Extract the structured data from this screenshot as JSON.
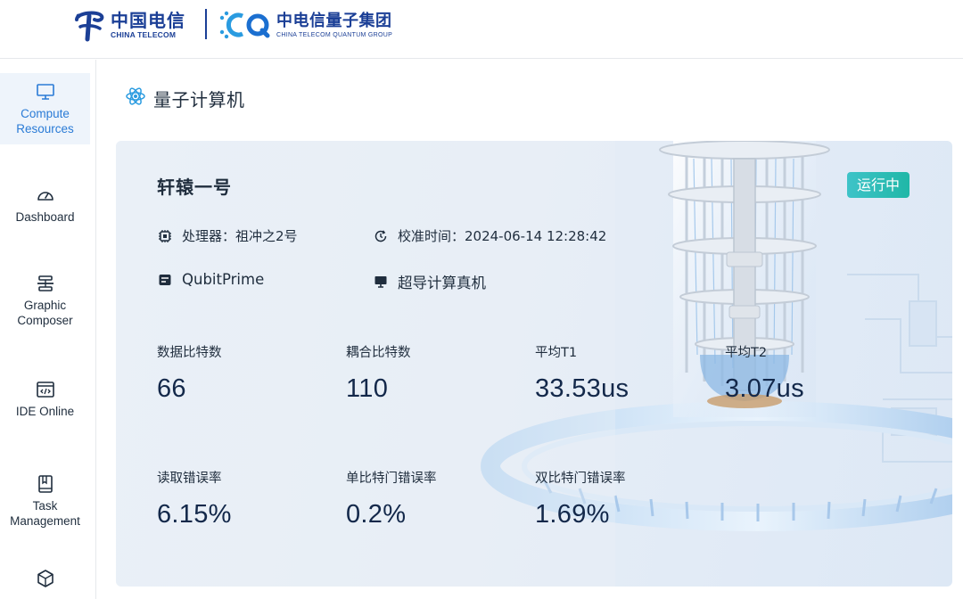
{
  "header": {
    "brand_cn": "中国电信",
    "brand_en": "CHINA TELECOM",
    "quantum_cn": "中电信量子集团",
    "quantum_en": "CHINA TELECOM QUANTUM GROUP"
  },
  "sidebar": {
    "items": [
      {
        "label": "Compute Resources",
        "icon": "monitor-icon",
        "active": true
      },
      {
        "label": "Dashboard",
        "icon": "gauge-icon"
      },
      {
        "label": "Graphic Composer",
        "icon": "layers-icon"
      },
      {
        "label": "IDE Online",
        "icon": "code-window-icon"
      },
      {
        "label": "Task Management",
        "icon": "book-icon"
      },
      {
        "label": "",
        "icon": "cube-icon"
      }
    ]
  },
  "page": {
    "title": "量子计算机",
    "title_icon": "quantum-icon"
  },
  "device": {
    "name": "轩辕一号",
    "status": "运行中",
    "processor": "处理器：祖冲之2号",
    "calibration": "校准时间：2024-06-14 12:28:42",
    "platform": "QubitPrime",
    "type": "超导计算真机",
    "stats": [
      {
        "label": "数据比特数",
        "value": "66"
      },
      {
        "label": "耦合比特数",
        "value": "110"
      },
      {
        "label": "平均T1",
        "value": "33.53us"
      },
      {
        "label": "平均T2",
        "value": "3.07us"
      },
      {
        "label": "读取错误率",
        "value": "6.15%"
      },
      {
        "label": "单比特门错误率",
        "value": "0.2%"
      },
      {
        "label": "双比特门错误率",
        "value": "1.69%"
      }
    ]
  },
  "colors": {
    "brand": "#1b3f96",
    "accent": "#2a7bd6",
    "status": "#20b7a7"
  }
}
